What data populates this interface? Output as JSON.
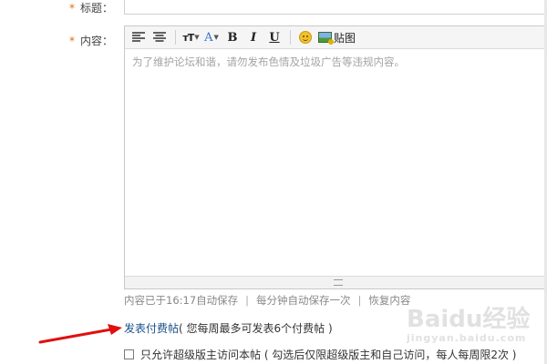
{
  "form": {
    "required_mark": "*",
    "title_label": "标题：",
    "content_label": "内容："
  },
  "editor": {
    "toolbar": {
      "align_left_icon": "align-left-icon",
      "align_center_icon": "align-center-icon",
      "font_size_label": "тT",
      "font_color_label": "A",
      "bold_label": "B",
      "italic_label": "I",
      "underline_label": "U",
      "emoji_icon": "smiley-icon",
      "image_label": "贴图"
    },
    "placeholder": "为了维护论坛和谐，请勿发布色情及垃圾广告等违规内容。"
  },
  "status": {
    "autosave_text": "内容已于16:17自动保存",
    "sep": "|",
    "interval_text": "每分钟自动保存一次",
    "restore_label": "恢复内容"
  },
  "paid_post": {
    "link_label": "发表付费帖",
    "note": "( 您每周最多可发表6个付费帖 )"
  },
  "moderator_only": {
    "label": "只允许超级版主访问本帖 ( 勾选后仅限超级版主和自己访问，每人每周限2次 )"
  },
  "watermark": {
    "text": "Baidu经验",
    "sub": "jingyan.baidu.com"
  },
  "colors": {
    "required": "#e36c09",
    "link": "#1a4f8a",
    "arrow": "#e01010"
  }
}
